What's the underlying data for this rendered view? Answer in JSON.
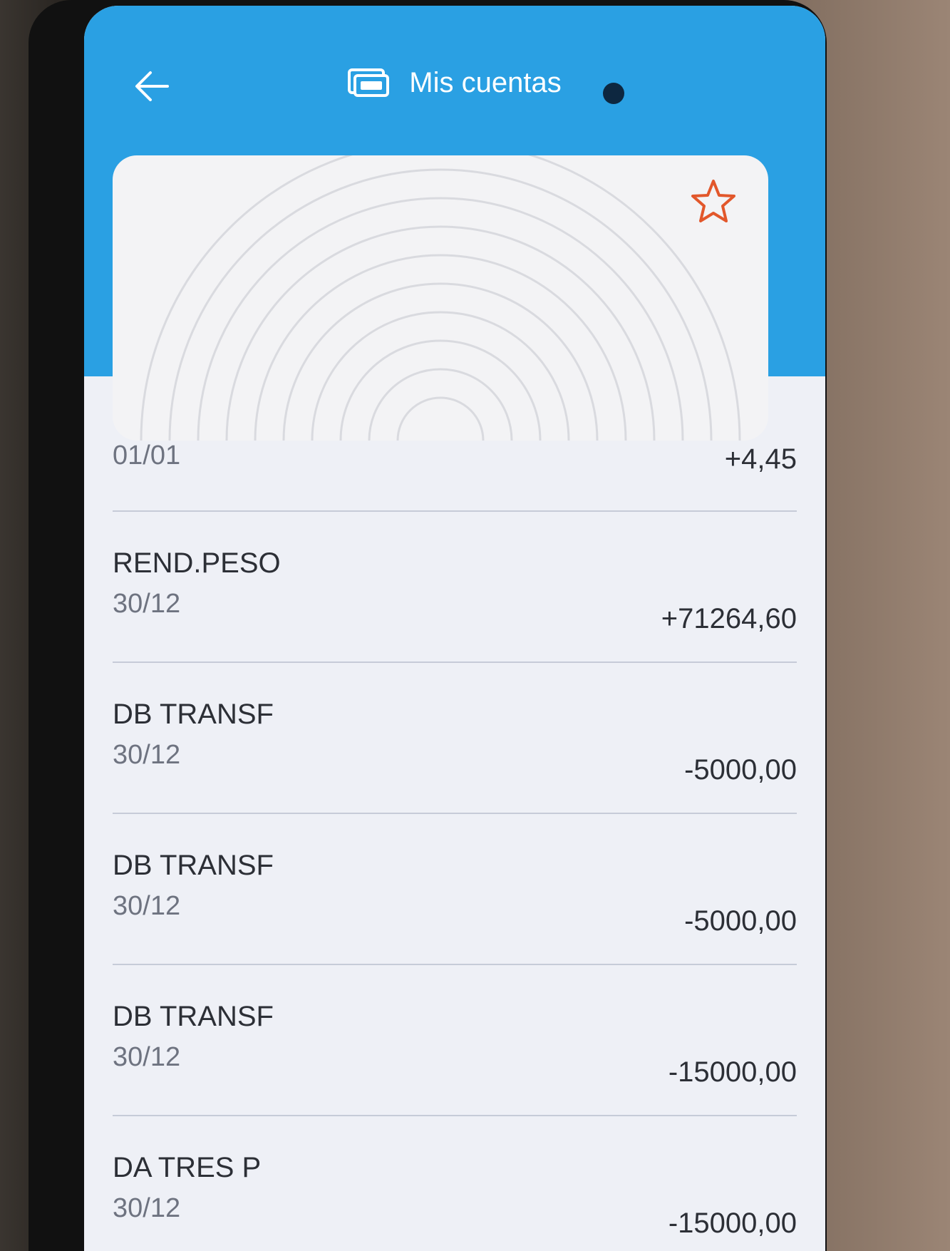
{
  "header": {
    "title": "Mis cuentas",
    "back_icon": "arrow-left-icon",
    "title_icon": "wallet-card-icon",
    "accent_color": "#2aa0e3"
  },
  "account_card": {
    "favorite_icon": "star-outline-icon",
    "favorite_color": "#e2572b"
  },
  "first_entry": {
    "date": "01/01",
    "amount": "+4,45"
  },
  "transactions": [
    {
      "description": "REND.PESO",
      "date": "30/12",
      "amount": "+71264,60"
    },
    {
      "description": "DB TRANSF",
      "date": "30/12",
      "amount": "-5000,00"
    },
    {
      "description": "DB TRANSF",
      "date": "30/12",
      "amount": "-5000,00"
    },
    {
      "description": "DB TRANSF",
      "date": "30/12",
      "amount": "-15000,00"
    },
    {
      "description": "DA TRES P",
      "date": "30/12",
      "amount": "-15000,00"
    }
  ]
}
